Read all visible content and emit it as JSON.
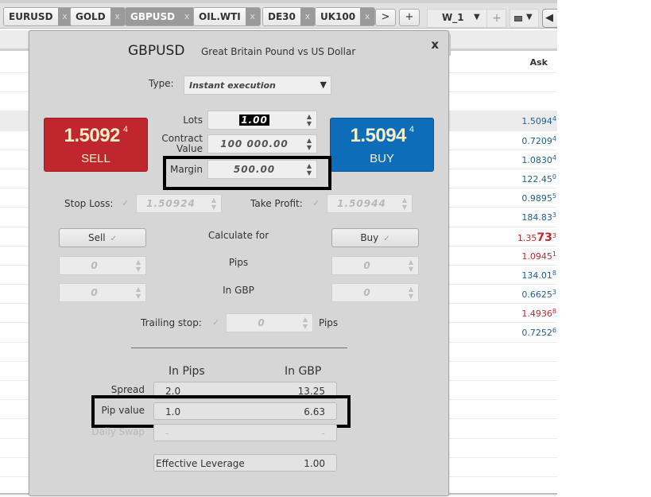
{
  "tabbar": {
    "symbols": [
      {
        "label": "EURUSD",
        "active": false
      },
      {
        "label": "GOLD",
        "active": false
      },
      {
        "label": "GBPUSD",
        "active": true
      },
      {
        "label": "OIL.WTI",
        "active": false
      },
      {
        "label": "DE30",
        "active": false
      },
      {
        "label": "UK100",
        "active": false
      }
    ],
    "close_glyph": "x",
    "more_label": ">",
    "add_label": "+",
    "workspace": {
      "name": "W_1",
      "arrow": "▼",
      "add": "+"
    },
    "layout_arrow": "▼",
    "back_arrow": "◀"
  },
  "panel": {
    "close_label": "x",
    "ask_header": "Ask",
    "rows": [
      {
        "ask": "",
        "pip": "",
        "color": "blue"
      },
      {
        "ask": "",
        "pip": "",
        "color": "blue"
      },
      {
        "ask": "1.5094",
        "pip": "4",
        "color": "blue",
        "highlight": true
      },
      {
        "ask": "0.7209",
        "pip": "4",
        "color": "blue"
      },
      {
        "ask": "1.0830",
        "pip": "4",
        "color": "blue"
      },
      {
        "ask": "122.45",
        "pip": "0",
        "color": "blue"
      },
      {
        "ask": "0.9895",
        "pip": "5",
        "color": "blue"
      },
      {
        "ask": "184.83",
        "pip": "3",
        "color": "blue"
      },
      {
        "ask_prefix": "1.35",
        "ask_big": "73",
        "pip": "3",
        "color": "red"
      },
      {
        "ask": "1.0945",
        "pip": "1",
        "color": "red"
      },
      {
        "ask": "134.01",
        "pip": "8",
        "color": "blue"
      },
      {
        "ask": "0.6625",
        "pip": "3",
        "color": "blue"
      },
      {
        "ask": "1.4936",
        "pip": "8",
        "color": "red"
      },
      {
        "ask": "0.7252",
        "pip": "6",
        "color": "blue"
      }
    ]
  },
  "dialog": {
    "close_label": "x",
    "symbol": "GBPUSD",
    "description": "Great Britain Pound vs US Dollar",
    "type_label": "Type:",
    "type_value": "Instant execution",
    "sell": {
      "price": "1.5092",
      "pip": "4",
      "label": "SELL",
      "color": "#c0262e"
    },
    "buy": {
      "price": "1.5094",
      "pip": "4",
      "label": "BUY",
      "color": "#0d6db8"
    },
    "lots_label": "Lots",
    "lots_value": "1.00",
    "contract_label_1": "Contract",
    "contract_label_2": "Value",
    "contract_value": "100 000.00",
    "margin_label": "Margin",
    "margin_value": "500.00",
    "stop_loss_label": "Stop Loss:",
    "stop_loss_value": "1.50924",
    "take_profit_label": "Take Profit:",
    "take_profit_value": "1.50944",
    "calc_sell_label": "Sell",
    "calc_buy_label": "Buy",
    "calculate_for_label": "Calculate for",
    "pips_label": "Pips",
    "in_gbp_label": "In GBP",
    "sell_pips_value": "0",
    "buy_pips_value": "0",
    "sell_gbp_value": "0",
    "buy_gbp_value": "0",
    "trailing_label": "Trailing stop:",
    "trailing_value": "0",
    "trailing_unit": "Pips",
    "col_in_pips": "In Pips",
    "col_in_gbp": "In GBP",
    "spread_label": "Spread",
    "spread_pips": "2.0",
    "spread_gbp": "13.25",
    "pip_value_label": "Pip value",
    "pip_value_pips": "1.0",
    "pip_value_gbp": "6.63",
    "daily_swap_label": "Daily Swap",
    "daily_swap_pips": "-",
    "daily_swap_gbp": "-",
    "leverage_label": "Effective Leverage",
    "leverage_value": "1.00",
    "check_glyph": "✓",
    "spin_up": "▲",
    "spin_down": "▼"
  }
}
